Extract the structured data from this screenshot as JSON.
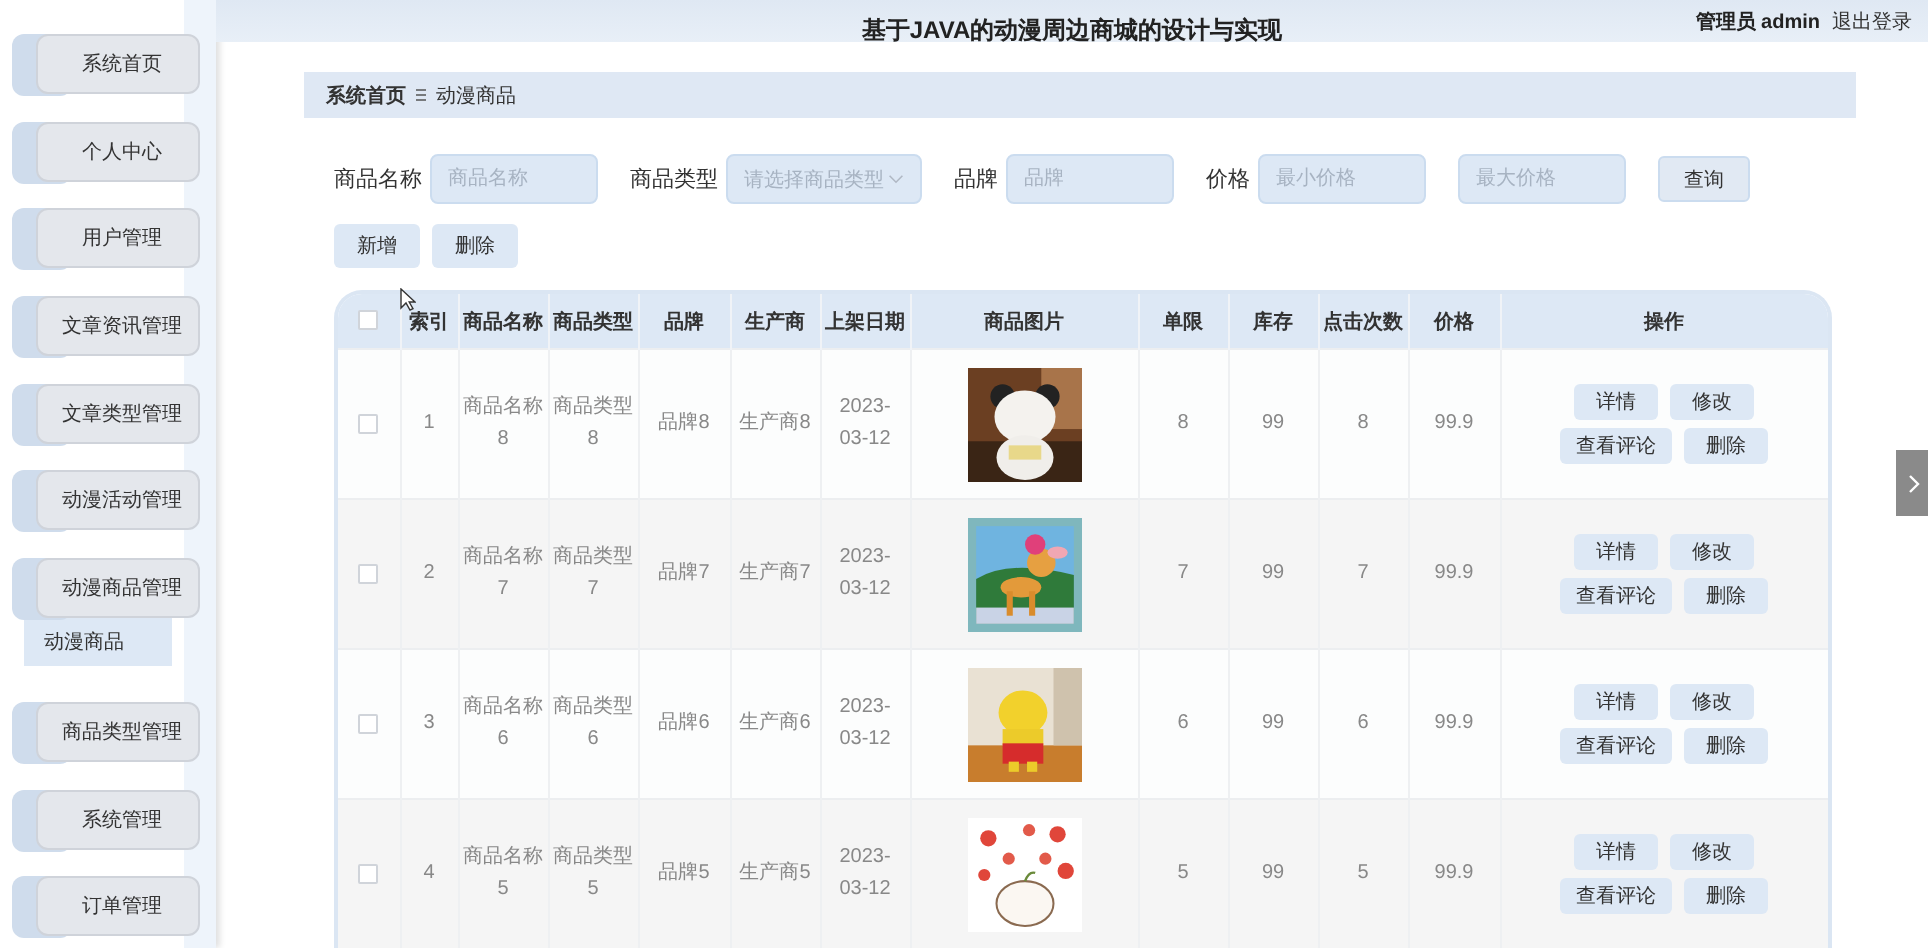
{
  "header": {
    "title": "基于JAVA的动漫周边商城的设计与实现",
    "user": "管理员 admin",
    "logout": "退出登录"
  },
  "sidebar": {
    "items": [
      {
        "label": "系统首页"
      },
      {
        "label": "个人中心"
      },
      {
        "label": "用户管理"
      },
      {
        "label": "文章资讯管理"
      },
      {
        "label": "文章类型管理"
      },
      {
        "label": "动漫活动管理"
      },
      {
        "label": "动漫商品管理",
        "children": [
          {
            "label": "动漫商品",
            "selected": true
          }
        ]
      },
      {
        "label": "商品类型管理"
      },
      {
        "label": "系统管理"
      },
      {
        "label": "订单管理"
      }
    ]
  },
  "breadcrumb": [
    "系统首页",
    "动漫商品"
  ],
  "filters": [
    {
      "kind": "text",
      "label": "商品名称",
      "placeholder": "商品名称"
    },
    {
      "kind": "select",
      "label": "商品类型",
      "placeholder": "请选择商品类型"
    },
    {
      "kind": "text",
      "label": "品牌",
      "placeholder": "品牌"
    },
    {
      "kind": "text",
      "label": "价格",
      "placeholder": "最小价格"
    },
    {
      "kind": "text",
      "placeholder": "最大价格"
    }
  ],
  "search_button": "查询",
  "actions": [
    "新增",
    "删除"
  ],
  "table": {
    "select_all_checked": false,
    "columns": [
      "索引",
      "商品名称",
      "商品类型",
      "品牌",
      "生产商",
      "上架日期",
      "商品图片",
      "单限",
      "库存",
      "点击次数",
      "价格",
      "操作"
    ],
    "rows": [
      {
        "checked": false,
        "cells": [
          "1",
          "商品名称8",
          "商品类型8",
          "品牌8",
          "生产商8",
          "2023-03-12"
        ],
        "picture": {
          "kind": "picture"
        },
        "cells2": [
          "8",
          "99",
          "8",
          "99.9"
        ],
        "buttons": [
          "详情",
          "修改",
          "查看评论",
          "删除"
        ]
      },
      {
        "checked": false,
        "cells": [
          "2",
          "商品名称7",
          "商品类型7",
          "品牌7",
          "生产商7",
          "2023-03-12"
        ],
        "picture": {
          "kind": "picture"
        },
        "cells2": [
          "7",
          "99",
          "7",
          "99.9"
        ],
        "buttons": [
          "详情",
          "修改",
          "查看评论",
          "删除"
        ]
      },
      {
        "checked": false,
        "cells": [
          "3",
          "商品名称6",
          "商品类型6",
          "品牌6",
          "生产商6",
          "2023-03-12"
        ],
        "picture": {
          "kind": "picture"
        },
        "cells2": [
          "6",
          "99",
          "6",
          "99.9"
        ],
        "buttons": [
          "详情",
          "修改",
          "查看评论",
          "删除"
        ]
      },
      {
        "checked": false,
        "cells": [
          "4",
          "商品名称5",
          "商品类型5",
          "品牌5",
          "生产商5",
          "2023-03-12"
        ],
        "picture": {
          "kind": "picture"
        },
        "cells2": [
          "5",
          "99",
          "5",
          "99.9"
        ],
        "buttons": [
          "详情",
          "修改",
          "查看评论",
          "删除"
        ]
      }
    ]
  }
}
